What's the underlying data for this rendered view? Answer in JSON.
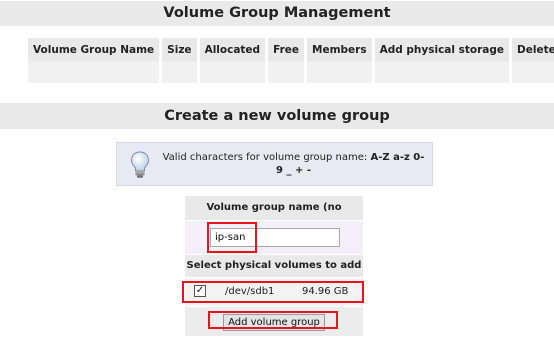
{
  "vg_management": {
    "title": "Volume Group Management",
    "columns": [
      "Volume Group Name",
      "Size",
      "Allocated",
      "Free",
      "Members",
      "Add physical storage",
      "Delete VG"
    ]
  },
  "create_vg": {
    "title": "Create a new volume group",
    "info": {
      "icon": "lightbulb-icon",
      "text": "Valid characters for volume group name:",
      "chars": "A-Z a-z 0-9 _ + -"
    },
    "name_label": "Volume group name (no spaces)",
    "name_value": "ip-san",
    "pv_label": "Select physical volumes to add",
    "pv": {
      "checked": true,
      "checkmark": "✓",
      "device": "/dev/sdb1",
      "size": "94.96 GB"
    },
    "submit_label": "Add volume group"
  },
  "highlight_color": "#e8141b"
}
